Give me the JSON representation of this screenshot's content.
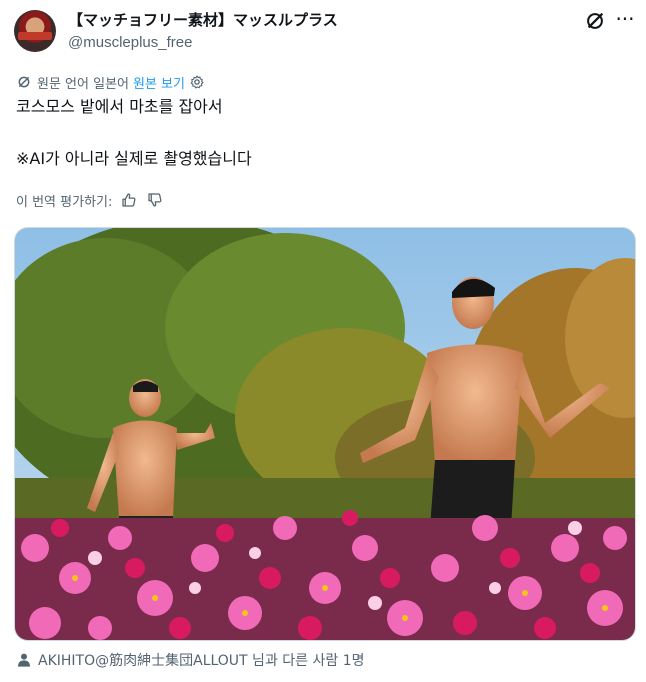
{
  "header": {
    "display_name": "【マッチョフリー素材】マッスルプラス",
    "handle": "@muscleplus_free",
    "grok_icon": "grok-icon",
    "more_icon": "more-icon",
    "more_glyph": "···"
  },
  "translation": {
    "note": "원문 언어 일본어",
    "show_original": "원본 보기",
    "settings_icon": "gear-icon"
  },
  "tweet": {
    "line1": "코스모스 밭에서 마초를 잡아서",
    "line2": "※AI가 아니라 실제로 촬영했습니다"
  },
  "rate": {
    "label": "이 번역 평가하기:",
    "thumbs_up_icon": "thumbs-up-icon",
    "thumbs_down_icon": "thumbs-down-icon"
  },
  "media": {
    "description_icon": "photo"
  },
  "tagged": {
    "text": "AKIHITO@筋肉紳士集団ALLOUT 님과 다른 사람 1명",
    "icon": "person-icon"
  },
  "colors": {
    "text": "#0f1419",
    "secondary": "#536471",
    "link": "#1d9bf0",
    "border": "#cfd9de"
  }
}
